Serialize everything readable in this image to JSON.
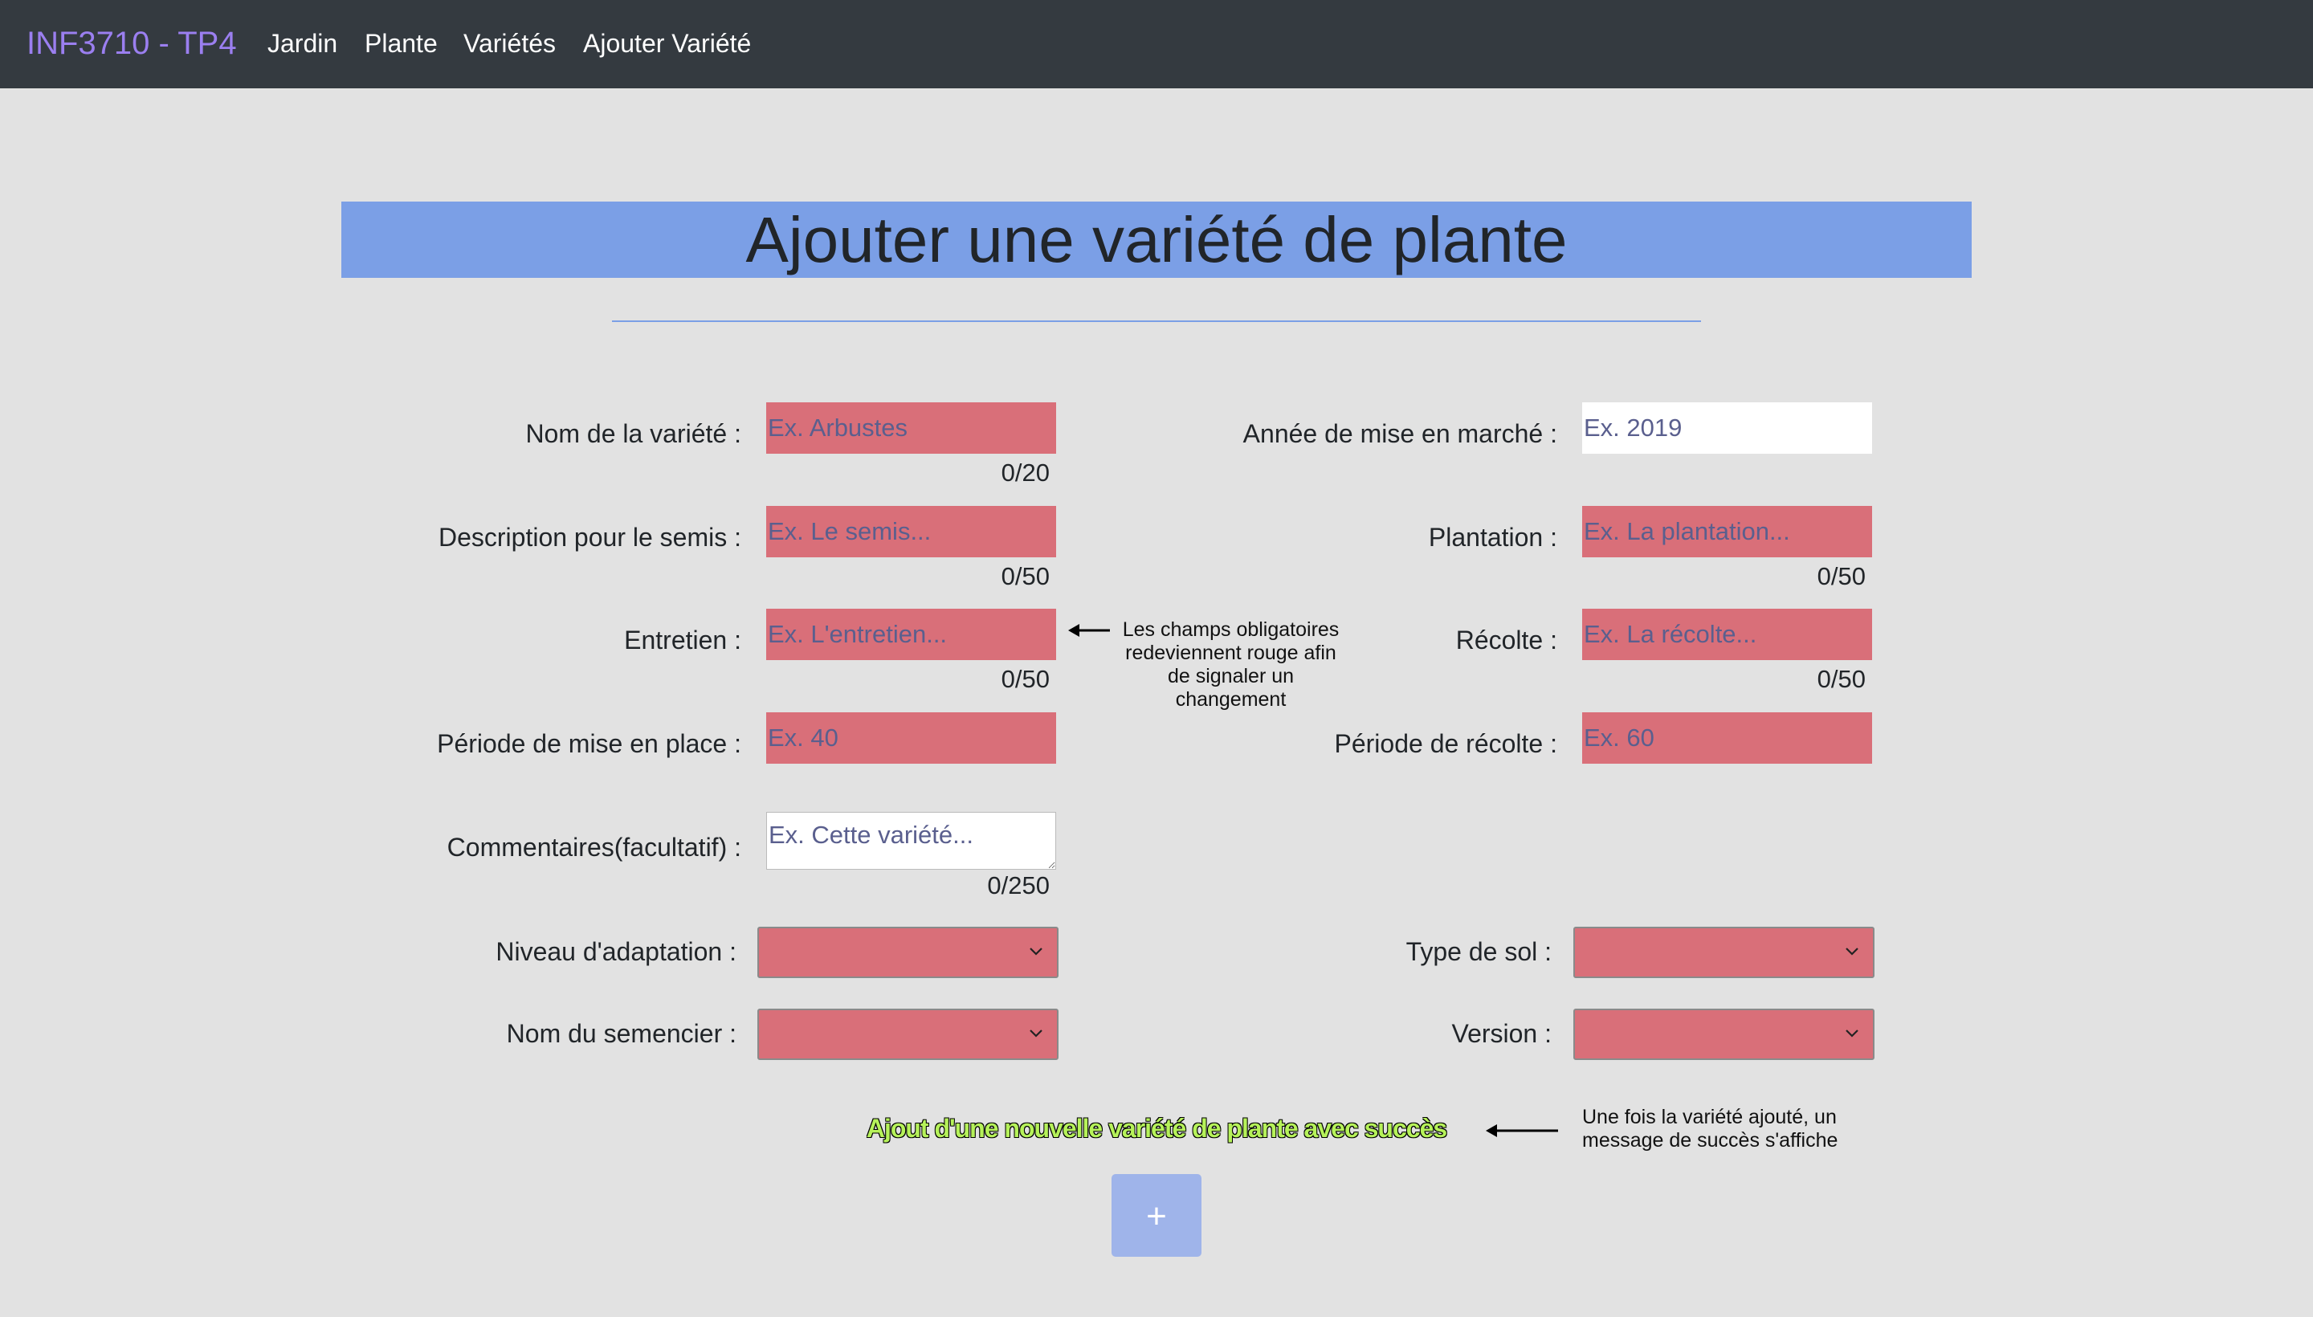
{
  "nav": {
    "brand": "INF3710 - TP4",
    "links": [
      "Jardin",
      "Plante",
      "Variétés",
      "Ajouter Variété"
    ]
  },
  "page_title": "Ajouter une variété de plante",
  "form": {
    "variety_name": {
      "label": "Nom de la variété :",
      "placeholder": "Ex. Arbustes",
      "counter": "0/20"
    },
    "release_year": {
      "label": "Année de mise en marché :",
      "placeholder": "Ex. 2019"
    },
    "sowing_description": {
      "label": "Description pour le semis :",
      "placeholder": "Ex. Le semis...",
      "counter": "0/50"
    },
    "planting": {
      "label": "Plantation :",
      "placeholder": "Ex. La plantation...",
      "counter": "0/50"
    },
    "maintenance": {
      "label": "Entretien :",
      "placeholder": "Ex. L'entretien...",
      "counter": "0/50"
    },
    "harvest": {
      "label": "Récolte :",
      "placeholder": "Ex. La récolte...",
      "counter": "0/50"
    },
    "setup_period": {
      "label": "Période de mise en place :",
      "placeholder": "Ex. 40"
    },
    "harvest_period": {
      "label": "Période de récolte :",
      "placeholder": "Ex. 60"
    },
    "comments": {
      "label": "Commentaires(facultatif) :",
      "placeholder": "Ex. Cette variété...",
      "counter": "0/250"
    },
    "adaptation_level": {
      "label": "Niveau d'adaptation :",
      "value": ""
    },
    "soil_type": {
      "label": "Type de sol :",
      "value": ""
    },
    "seed_company": {
      "label": "Nom du semencier :",
      "value": ""
    },
    "version": {
      "label": "Version :",
      "value": ""
    },
    "submit_label": "+"
  },
  "annotations": {
    "required_fields_note": [
      "Les champs obligatoires",
      "redeviennent rouge afin",
      "de signaler un",
      "changement"
    ],
    "success_note": [
      "Une fois la variété ajouté, un",
      "message de succès s'affiche"
    ]
  },
  "success_message": "Ajout d'une nouvelle variété de plante avec succès",
  "colors": {
    "navbar": "#343a40",
    "brand": "#9b7ff0",
    "title_bg": "#7b9fe6",
    "required_field": "#d96f79",
    "success_text": "#b6f25a",
    "submit_button": "#9fb4ea",
    "page_bg": "#e2e2e2"
  }
}
